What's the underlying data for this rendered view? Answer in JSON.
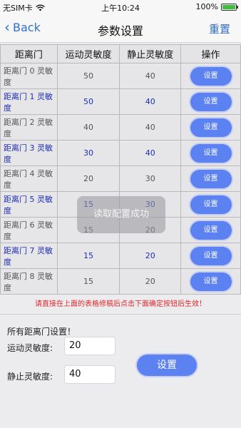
{
  "status": {
    "carrier": "无SIM卡",
    "time": "上午10:24",
    "battery_text": "100%",
    "battery_level": 1.0
  },
  "nav": {
    "back_label": "Back",
    "title": "参数设置",
    "reset_label": "重置"
  },
  "table": {
    "headers": [
      "距离门",
      "运动灵敏度",
      "静止灵敏度",
      "操作"
    ],
    "rows": [
      {
        "name": "距离门 0 灵敏度",
        "motion": "50",
        "static": "40",
        "action": "设置"
      },
      {
        "name": "距离门 1 灵敏度",
        "motion": "50",
        "static": "40",
        "action": "设置"
      },
      {
        "name": "距离门 2 灵敏度",
        "motion": "40",
        "static": "40",
        "action": "设置"
      },
      {
        "name": "距离门 3 灵敏度",
        "motion": "30",
        "static": "40",
        "action": "设置"
      },
      {
        "name": "距离门 4 灵敏度",
        "motion": "20",
        "static": "30",
        "action": "设置"
      },
      {
        "name": "距离门 5 灵敏度",
        "motion": "15",
        "static": "30",
        "action": "设置"
      },
      {
        "name": "距离门 6 灵敏度",
        "motion": "15",
        "static": "20",
        "action": "设置"
      },
      {
        "name": "距离门 7 灵敏度",
        "motion": "15",
        "static": "20",
        "action": "设置"
      },
      {
        "name": "距离门 8 灵敏度",
        "motion": "15",
        "static": "20",
        "action": "设置"
      }
    ]
  },
  "toast": "读取配置成功",
  "hint": "请直接在上面的表格修稿后点击下面确定按钮后生效！",
  "all_gates": {
    "title": "所有距离门设置！",
    "motion_label": "运动灵敏度:",
    "motion_value": "20",
    "static_label": "静止灵敏度:",
    "static_value": "40",
    "set_label": "设置"
  },
  "colors": {
    "accent": "#5b82f0",
    "link": "#2f6fd3",
    "odd_text": "#1f2fb3",
    "hint": "#e0262a"
  }
}
